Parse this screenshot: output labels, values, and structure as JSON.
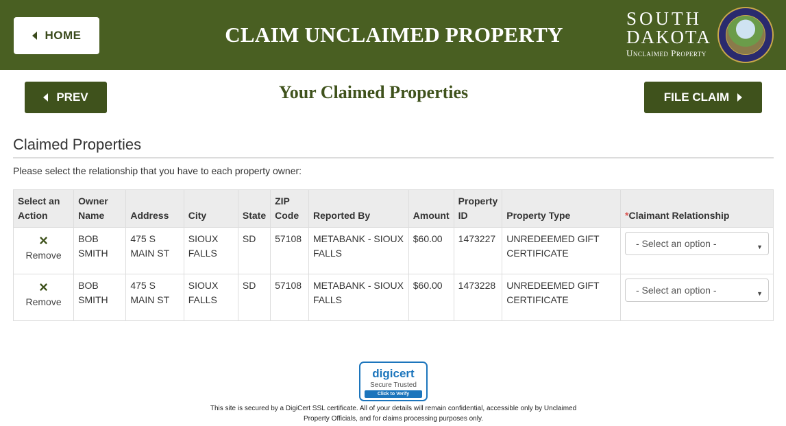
{
  "header": {
    "home_label": "HOME",
    "title": "CLAIM UNCLAIMED PROPERTY",
    "brand_line1": "SOUTH",
    "brand_line2": "DAKOTA",
    "brand_line3": "Unclaimed Property"
  },
  "nav": {
    "prev_label": "PREV",
    "page_title": "Your Claimed Properties",
    "file_claim_label": "FILE CLAIM"
  },
  "section": {
    "title": "Claimed Properties",
    "instruction": "Please select the relationship that you have to each property owner:"
  },
  "table": {
    "headers": {
      "action": "Select an Action",
      "owner": "Owner Name",
      "address": "Address",
      "city": "City",
      "state": "State",
      "zip": "ZIP Code",
      "reported_by": "Reported By",
      "amount": "Amount",
      "property_id": "Property ID",
      "property_type": "Property Type",
      "relationship_required": "*",
      "relationship": "Claimant Relationship"
    },
    "rows": [
      {
        "remove_icon": "×",
        "remove_label": "Remove",
        "owner": "BOB SMITH",
        "address": "475 S MAIN ST",
        "city": "SIOUX FALLS",
        "state": "SD",
        "zip": "57108",
        "reported_by": "METABANK - SIOUX FALLS",
        "amount": "$60.00",
        "property_id": "1473227",
        "property_type": "UNREDEEMED GIFT CERTIFICATE",
        "relationship": "- Select an option -"
      },
      {
        "remove_icon": "×",
        "remove_label": "Remove",
        "owner": "BOB SMITH",
        "address": "475 S MAIN ST",
        "city": "SIOUX FALLS",
        "state": "SD",
        "zip": "57108",
        "reported_by": "METABANK - SIOUX FALLS",
        "amount": "$60.00",
        "property_id": "1473228",
        "property_type": "UNREDEEMED GIFT CERTIFICATE",
        "relationship": "- Select an option -"
      }
    ]
  },
  "footer": {
    "badge_logo": "digicert",
    "badge_sub": "Secure Trusted",
    "badge_click": "Click to Verify",
    "text": "This site is secured by a DigiCert SSL certificate. All of your details will remain confidential, accessible only by Unclaimed Property Officials, and for claims processing purposes only."
  },
  "colors": {
    "header_bg": "#495f22",
    "button_bg": "#3f521c",
    "required": "#d9534f",
    "digicert_blue": "#1c75bc"
  }
}
